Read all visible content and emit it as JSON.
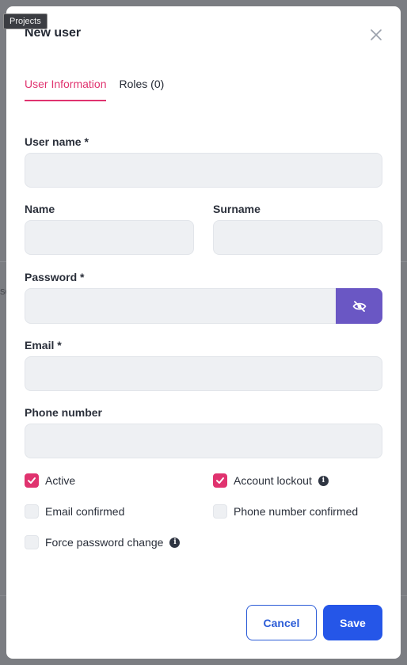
{
  "tooltip": "Projects",
  "backdrop_snippet": "se",
  "modal": {
    "title": "New user",
    "tabs": [
      {
        "label": "User Information"
      },
      {
        "label": "Roles (0)"
      }
    ],
    "fields": {
      "username_label": "User name *",
      "name_label": "Name",
      "surname_label": "Surname",
      "password_label": "Password *",
      "email_label": "Email *",
      "phone_label": "Phone number"
    },
    "values": {
      "username": "",
      "name": "",
      "surname": "",
      "password": "",
      "email": "",
      "phone": ""
    },
    "checkboxes": [
      {
        "label": "Active",
        "checked": true
      },
      {
        "label": "Account lockout",
        "checked": true
      },
      {
        "label": "Email confirmed",
        "checked": false
      },
      {
        "label": "Phone number confirmed",
        "checked": false
      },
      {
        "label": "Force password change",
        "checked": false
      }
    ],
    "buttons": {
      "cancel": "Cancel",
      "save": "Save"
    }
  },
  "colors": {
    "accent": "#e0336f",
    "primary": "#2556e8",
    "eye_button": "#6a57c4"
  },
  "icons": {
    "close": "close-icon",
    "password_visibility": "eye-slash-icon",
    "info": "info-icon",
    "check": "check-icon"
  }
}
